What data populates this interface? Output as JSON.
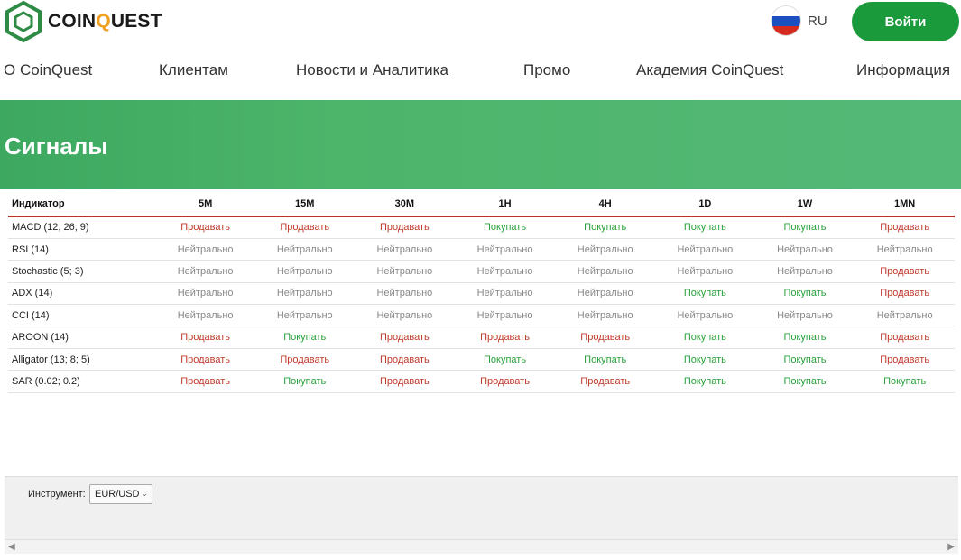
{
  "header": {
    "logo_text_before": "COIN",
    "logo_text_q": "Q",
    "logo_text_after": "UEST",
    "lang": "RU",
    "login": "Войти"
  },
  "nav": [
    {
      "label": "О CoinQuest"
    },
    {
      "label": "Клиентам"
    },
    {
      "label": "Новости и Аналитика"
    },
    {
      "label": "Промо"
    },
    {
      "label": "Академия CoinQuest"
    },
    {
      "label": "Информация"
    }
  ],
  "banner": {
    "title": "Сигналы"
  },
  "table": {
    "headers": [
      "Индикатор",
      "5M",
      "15M",
      "30M",
      "1H",
      "4H",
      "1D",
      "1W",
      "1MN"
    ],
    "rows": [
      {
        "name": "MACD (12; 26; 9)",
        "cells": [
          "Продавать",
          "Продавать",
          "Продавать",
          "Покупать",
          "Покупать",
          "Покупать",
          "Покупать",
          "Продавать"
        ]
      },
      {
        "name": "RSI (14)",
        "cells": [
          "Нейтрально",
          "Нейтрально",
          "Нейтрально",
          "Нейтрально",
          "Нейтрально",
          "Нейтрально",
          "Нейтрально",
          "Нейтрально"
        ]
      },
      {
        "name": "Stochastic (5; 3)",
        "cells": [
          "Нейтрально",
          "Нейтрально",
          "Нейтрально",
          "Нейтрально",
          "Нейтрально",
          "Нейтрально",
          "Нейтрально",
          "Продавать"
        ]
      },
      {
        "name": "ADX (14)",
        "cells": [
          "Нейтрально",
          "Нейтрально",
          "Нейтрально",
          "Нейтрально",
          "Нейтрально",
          "Покупать",
          "Покупать",
          "Продавать"
        ]
      },
      {
        "name": "CCI (14)",
        "cells": [
          "Нейтрально",
          "Нейтрально",
          "Нейтрально",
          "Нейтрально",
          "Нейтрально",
          "Нейтрально",
          "Нейтрально",
          "Нейтрально"
        ]
      },
      {
        "name": "AROON (14)",
        "cells": [
          "Продавать",
          "Покупать",
          "Продавать",
          "Продавать",
          "Продавать",
          "Покупать",
          "Покупать",
          "Продавать"
        ]
      },
      {
        "name": "Alligator (13; 8; 5)",
        "cells": [
          "Продавать",
          "Продавать",
          "Продавать",
          "Покупать",
          "Покупать",
          "Покупать",
          "Покупать",
          "Продавать"
        ]
      },
      {
        "name": "SAR (0.02; 0.2)",
        "cells": [
          "Продавать",
          "Покупать",
          "Продавать",
          "Продавать",
          "Продавать",
          "Покупать",
          "Покупать",
          "Покупать"
        ]
      }
    ]
  },
  "instrument": {
    "label": "Инструмент:",
    "value": "EUR/USD"
  },
  "colors": {
    "accent": "#1a9a3a",
    "sell": "#c0392b",
    "buy": "#27a03a",
    "neutral": "#888888"
  }
}
